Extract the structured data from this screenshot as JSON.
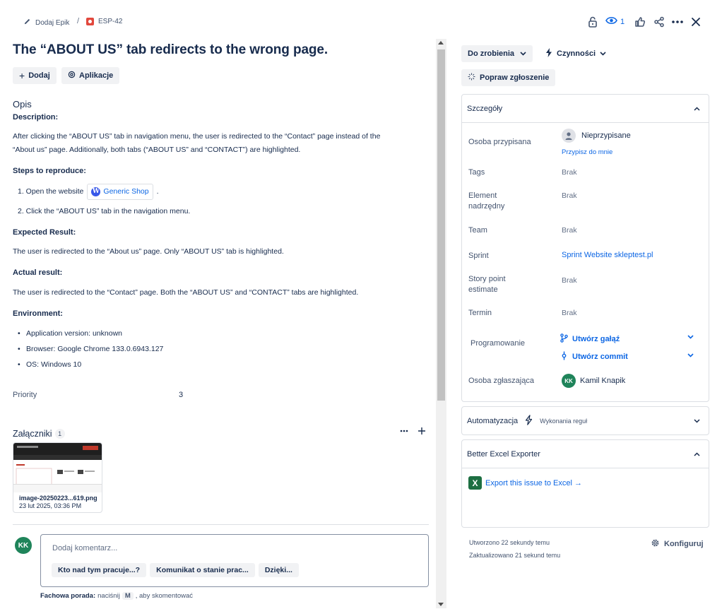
{
  "header": {
    "add_epic": "Dodaj Epik",
    "separator": "/",
    "issue_key": "ESP-42",
    "watch_count": "1"
  },
  "issue": {
    "title": "The “ABOUT US” tab redirects to the wrong page.",
    "add_button": "Dodaj",
    "apps_button": "Aplikacje"
  },
  "description": {
    "heading": "Opis",
    "desc_label": "Description:",
    "desc_line1": "After clicking the “ABOUT US” tab in navigation menu, the user is redirected to the “Contact” page instead of the",
    "desc_line2": "“About us” page. Additionally, both tabs (“ABOUT US” and “CONTACT”) are highlighted.",
    "steps_label": "Steps to reproduce:",
    "step1_prefix": "1. Open the website",
    "step1_link": "Generic Shop",
    "step1_suffix": ".",
    "step2": "2. Click the “ABOUT US” tab in the navigation menu.",
    "expected_label": "Expected Result:",
    "expected_text": "The user is redirected to the “About us” page. Only “ABOUT US” tab is highlighted.",
    "actual_label": "Actual result:",
    "actual_text": "The user is redirected to the “Contact” page. Both the “ABOUT US” and “CONTACT” tabs are highlighted.",
    "env_label": "Environment:",
    "env_items": [
      "Application version: unknown",
      "Browser: Google Chrome 133.0.6943.127",
      "OS: Windows 10"
    ]
  },
  "priority": {
    "label": "Priority",
    "value": "3"
  },
  "attachments": {
    "heading": "Załączniki",
    "count": "1",
    "file_name": "image-20250223...619.png",
    "file_date": "23 lut 2025, 03:36 PM"
  },
  "comments": {
    "avatar_initials": "KK",
    "placeholder": "Dodaj komentarz...",
    "suggestions": [
      "Kto nad tym pracuje...?",
      "Komunikat o stanie prac...",
      "Dzięki..."
    ],
    "tip_bold": "Fachowa porada:",
    "tip_pre": "naciśnij",
    "tip_key": "M",
    "tip_post": ", aby skomentować"
  },
  "right_panel": {
    "status_button": "Do zrobienia",
    "actions_button": "Czynności",
    "improve_button": "Popraw zgłoszenie",
    "details": {
      "title": "Szczegóły",
      "assignee_label": "Osoba przypisana",
      "assignee_value": "Nieprzypisane",
      "assign_to_me": "Przypisz do mnie",
      "tags_label": "Tags",
      "tags_value": "Brak",
      "parent_label_1": "Element",
      "parent_label_2": "nadrzędny",
      "parent_value": "Brak",
      "team_label": "Team",
      "team_value": "Brak",
      "sprint_label": "Sprint",
      "sprint_value": "Sprint Website skleptest.pl",
      "story_label_1": "Story point",
      "story_label_2": "estimate",
      "story_value": "Brak",
      "due_label": "Termin",
      "due_value": "Brak",
      "dev_label": "Programowanie",
      "create_branch": "Utwórz gałąź",
      "create_commit": "Utwórz commit",
      "reporter_label": "Osoba zgłaszająca",
      "reporter_initials": "KK",
      "reporter_name": "Kamil Knapik"
    },
    "automation": {
      "title": "Automatyzacja",
      "rules": "Wykonania reguł"
    },
    "excel": {
      "title": "Better Excel Exporter",
      "export_link": "Export this issue to Excel →"
    },
    "created": "Utworzono 22 sekundy temu",
    "updated": "Zaktualizowano 21 sekund temu",
    "configure": "Konfiguruj"
  }
}
